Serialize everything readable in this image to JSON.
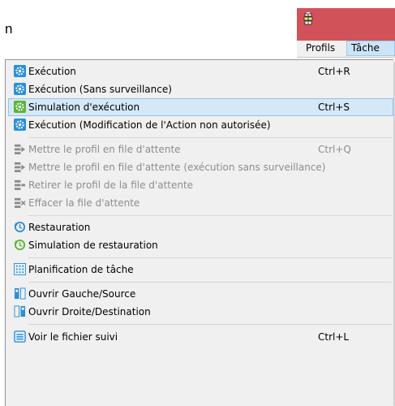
{
  "background_text": "n",
  "menubar": {
    "items": [
      "Profils",
      "Tâche"
    ]
  },
  "menu": {
    "items": [
      {
        "label": "Exécution",
        "shortcut": "Ctrl+R",
        "icon": "gear-icon"
      },
      {
        "label": "Exécution (Sans surveillance)",
        "shortcut": "",
        "icon": "gear-icon"
      },
      {
        "label": "Simulation d'exécution",
        "shortcut": "Ctrl+S",
        "icon": "gear-green-icon",
        "highlighted": true
      },
      {
        "label": "Exécution (Modification de l'Action non autorisée)",
        "shortcut": "",
        "icon": "gear-icon"
      },
      {
        "label": "Mettre le profil en file d'attente",
        "shortcut": "Ctrl+Q",
        "icon": "queue-add-icon",
        "disabled": true
      },
      {
        "label": "Mettre le profil en file d'attente (exécution sans surveillance)",
        "shortcut": "",
        "icon": "queue-add-icon",
        "disabled": true
      },
      {
        "label": "Retirer le profil de la file d'attente",
        "shortcut": "",
        "icon": "queue-remove-icon",
        "disabled": true
      },
      {
        "label": "Effacer la file d'attente",
        "shortcut": "",
        "icon": "queue-clear-icon",
        "disabled": true
      },
      {
        "label": "Restauration",
        "shortcut": "",
        "icon": "restore-icon"
      },
      {
        "label": "Simulation de restauration",
        "shortcut": "",
        "icon": "restore-green-icon"
      },
      {
        "label": "Planification de tâche",
        "shortcut": "",
        "icon": "schedule-grid-icon"
      },
      {
        "label": "Ouvrir Gauche/Source",
        "shortcut": "",
        "icon": "open-left-icon"
      },
      {
        "label": "Ouvrir Droite/Destination",
        "shortcut": "",
        "icon": "open-right-icon"
      },
      {
        "label": "Voir le fichier suivi",
        "shortcut": "Ctrl+L",
        "icon": "log-file-icon"
      }
    ]
  },
  "colors": {
    "titlebar": "#d2525a",
    "highlight_bg": "#d5e8f7",
    "highlight_border": "#90c3ec",
    "gear_blue": "#2a8fd8",
    "gear_green": "#5bb534",
    "disabled_text": "#8d8d8d"
  }
}
